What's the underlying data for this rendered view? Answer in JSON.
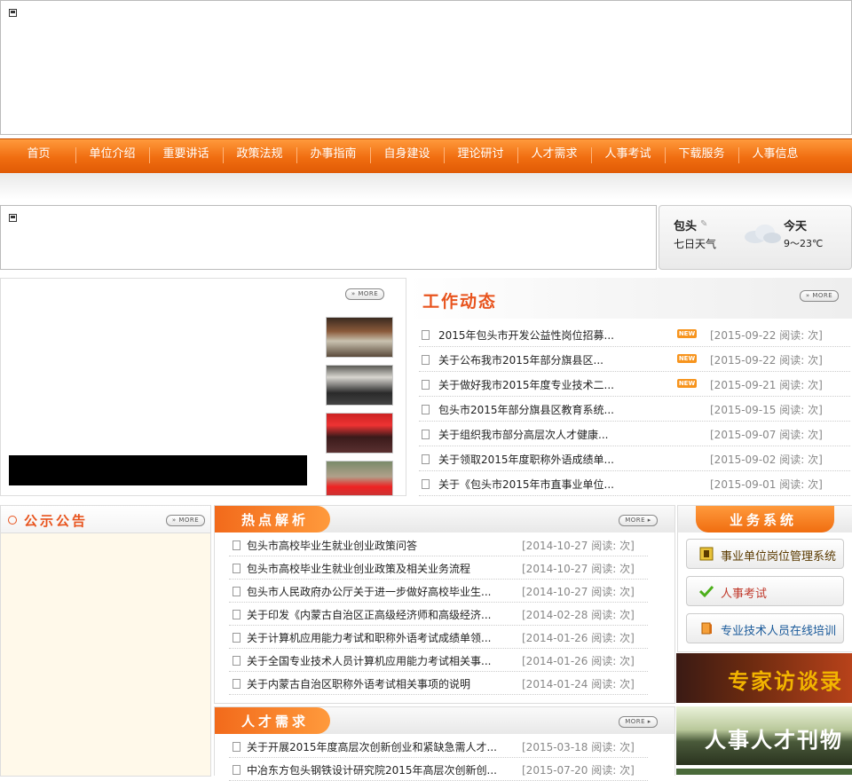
{
  "nav": {
    "items": [
      "首页",
      "单位介绍",
      "重要讲话",
      "政策法规",
      "办事指南",
      "自身建设",
      "理论研讨",
      "人才需求",
      "人事考试",
      "下载服务",
      "人事信息"
    ]
  },
  "weather": {
    "city": "包头",
    "seven_day": "七日天气",
    "today": "今天",
    "temp": "9～23℃"
  },
  "photo_news": {
    "more": "MORE"
  },
  "work_news": {
    "title": "工作动态",
    "more": "MORE",
    "new_badge": "NEW",
    "items": [
      {
        "title": "2015年包头市开发公益性岗位招募...",
        "date": "[2015-09-22 阅读: 次]",
        "new": true
      },
      {
        "title": "关于公布我市2015年部分旗县区...",
        "date": "[2015-09-22 阅读: 次]",
        "new": true
      },
      {
        "title": "关于做好我市2015年度专业技术二...",
        "date": "[2015-09-21 阅读: 次]",
        "new": true
      },
      {
        "title": "包头市2015年部分旗县区教育系统...",
        "date": "[2015-09-15 阅读: 次]",
        "new": false
      },
      {
        "title": "关于组织我市部分高层次人才健康...",
        "date": "[2015-09-07 阅读: 次]",
        "new": false
      },
      {
        "title": "关于领取2015年度职称外语成绩单...",
        "date": "[2015-09-02 阅读: 次]",
        "new": false
      },
      {
        "title": "关于《包头市2015年市直事业单位...",
        "date": "[2015-09-01 阅读: 次]",
        "new": false
      }
    ]
  },
  "notice": {
    "title": "公示公告",
    "more": "MORE"
  },
  "hot": {
    "title": "热点解析",
    "more": "MORE",
    "items": [
      {
        "title": "包头市高校毕业生就业创业政策问答",
        "date": "[2014-10-27 阅读: 次]"
      },
      {
        "title": "包头市高校毕业生就业创业政策及相关业务流程",
        "date": "[2014-10-27 阅读: 次]"
      },
      {
        "title": "包头市人民政府办公厅关于进一步做好高校毕业生...",
        "date": "[2014-10-27 阅读: 次]"
      },
      {
        "title": "关于印发《内蒙古自治区正高级经济师和高级经济...",
        "date": "[2014-02-28 阅读: 次]"
      },
      {
        "title": "关于计算机应用能力考试和职称外语考试成绩单领...",
        "date": "[2014-01-26 阅读: 次]"
      },
      {
        "title": "关于全国专业技术人员计算机应用能力考试相关事...",
        "date": "[2014-01-26 阅读: 次]"
      },
      {
        "title": "关于内蒙古自治区职称外语考试相关事项的说明",
        "date": "[2014-01-24 阅读: 次]"
      }
    ]
  },
  "talent": {
    "title": "人才需求",
    "more": "MORE",
    "items": [
      {
        "title": "关于开展2015年度高层次创新创业和紧缺急需人才...",
        "date": "[2015-03-18 阅读: 次]"
      },
      {
        "title": "中冶东方包头钢铁设计研究院2015年高层次创新创...",
        "date": "[2015-07-20 阅读: 次]"
      }
    ]
  },
  "biz": {
    "title": "业务系统",
    "buttons": [
      {
        "label": "事业单位岗位管理系统",
        "icon": "folder-icon",
        "color": "#5a3a00"
      },
      {
        "label": "人事考试",
        "icon": "checkmark-icon",
        "color": "#c0392b"
      },
      {
        "label": "专业技术人员在线培训",
        "icon": "pencil-book-icon",
        "color": "#1a5a9a"
      }
    ]
  },
  "promos": [
    {
      "label": "专家访谈录",
      "color": "#f2b400"
    },
    {
      "label": "人事人才刊物",
      "color": "#ffffff"
    }
  ],
  "colors": {
    "accent": "#e8541e",
    "nav": "#f06d10"
  }
}
